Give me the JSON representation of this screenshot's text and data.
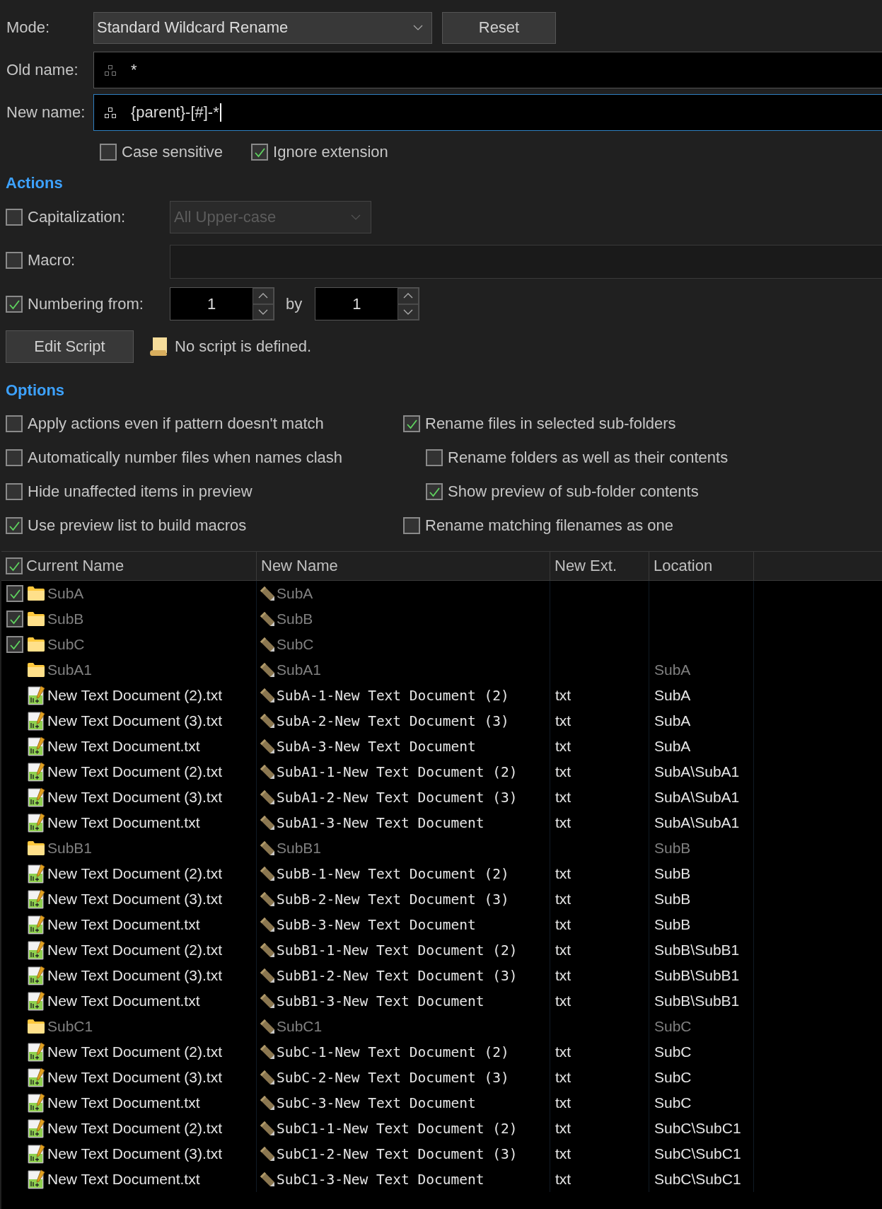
{
  "mode": {
    "label": "Mode:",
    "value": "Standard Wildcard Rename"
  },
  "reset_button": "Reset",
  "old_name": {
    "label": "Old name:",
    "value": "*",
    "focused": false
  },
  "new_name": {
    "label": "New name:",
    "value": "{parent}-[#]-*",
    "focused": true
  },
  "flags": [
    {
      "label": "Case sensitive",
      "checked": false
    },
    {
      "label": "Ignore extension",
      "checked": true
    }
  ],
  "actions": {
    "heading": "Actions",
    "capitalization": {
      "label": "Capitalization:",
      "checked": false,
      "value": "All Upper-case",
      "disabled": true
    },
    "macro": {
      "label": "Macro:",
      "checked": false
    },
    "numbering": {
      "label": "Numbering from:",
      "checked": true,
      "from": "1",
      "by_label": "by",
      "by": "1"
    },
    "edit_script_button": "Edit Script",
    "script_status": "No script is defined."
  },
  "options": {
    "heading": "Options",
    "left": [
      {
        "label": "Apply actions even if pattern doesn't match",
        "checked": false
      },
      {
        "label": "Automatically number files when names clash",
        "checked": false
      },
      {
        "label": "Hide unaffected items in preview",
        "checked": false
      },
      {
        "label": "Use preview list to build macros",
        "checked": true
      }
    ],
    "right": [
      {
        "label": "Rename files in selected sub-folders",
        "checked": true,
        "children": [
          {
            "label": "Rename folders as well as their contents",
            "checked": false
          },
          {
            "label": "Show preview of sub-folder contents",
            "checked": true
          }
        ]
      },
      {
        "label": "Rename matching filenames as one",
        "checked": false
      }
    ]
  },
  "table": {
    "header_checked": true,
    "columns": [
      "Current Name",
      "New Name",
      "New Ext.",
      "Location"
    ],
    "rows": [
      {
        "kind": "top_folder",
        "checked": true,
        "name": "SubA",
        "new_name": "SubA"
      },
      {
        "kind": "top_folder",
        "checked": true,
        "name": "SubB",
        "new_name": "SubB"
      },
      {
        "kind": "top_folder",
        "checked": true,
        "name": "SubC",
        "new_name": "SubC"
      },
      {
        "kind": "folder",
        "name": "SubA1",
        "new_name": "SubA1",
        "location": "SubA"
      },
      {
        "kind": "file",
        "name": "New Text Document (2).txt",
        "new_name": "SubA-1-New Text Document (2)",
        "ext": "txt",
        "location": "SubA"
      },
      {
        "kind": "file",
        "name": "New Text Document (3).txt",
        "new_name": "SubA-2-New Text Document (3)",
        "ext": "txt",
        "location": "SubA"
      },
      {
        "kind": "file",
        "name": "New Text Document.txt",
        "new_name": "SubA-3-New Text Document",
        "ext": "txt",
        "location": "SubA"
      },
      {
        "kind": "file",
        "name": "New Text Document (2).txt",
        "new_name": "SubA1-1-New Text Document (2)",
        "ext": "txt",
        "location": "SubA\\SubA1"
      },
      {
        "kind": "file",
        "name": "New Text Document (3).txt",
        "new_name": "SubA1-2-New Text Document (3)",
        "ext": "txt",
        "location": "SubA\\SubA1"
      },
      {
        "kind": "file",
        "name": "New Text Document.txt",
        "new_name": "SubA1-3-New Text Document",
        "ext": "txt",
        "location": "SubA\\SubA1"
      },
      {
        "kind": "folder",
        "name": "SubB1",
        "new_name": "SubB1",
        "location": "SubB"
      },
      {
        "kind": "file",
        "name": "New Text Document (2).txt",
        "new_name": "SubB-1-New Text Document (2)",
        "ext": "txt",
        "location": "SubB"
      },
      {
        "kind": "file",
        "name": "New Text Document (3).txt",
        "new_name": "SubB-2-New Text Document (3)",
        "ext": "txt",
        "location": "SubB"
      },
      {
        "kind": "file",
        "name": "New Text Document.txt",
        "new_name": "SubB-3-New Text Document",
        "ext": "txt",
        "location": "SubB"
      },
      {
        "kind": "file",
        "name": "New Text Document (2).txt",
        "new_name": "SubB1-1-New Text Document (2)",
        "ext": "txt",
        "location": "SubB\\SubB1"
      },
      {
        "kind": "file",
        "name": "New Text Document (3).txt",
        "new_name": "SubB1-2-New Text Document (3)",
        "ext": "txt",
        "location": "SubB\\SubB1"
      },
      {
        "kind": "file",
        "name": "New Text Document.txt",
        "new_name": "SubB1-3-New Text Document",
        "ext": "txt",
        "location": "SubB\\SubB1"
      },
      {
        "kind": "folder",
        "name": "SubC1",
        "new_name": "SubC1",
        "location": "SubC"
      },
      {
        "kind": "file",
        "name": "New Text Document (2).txt",
        "new_name": "SubC-1-New Text Document (2)",
        "ext": "txt",
        "location": "SubC"
      },
      {
        "kind": "file",
        "name": "New Text Document (3).txt",
        "new_name": "SubC-2-New Text Document (3)",
        "ext": "txt",
        "location": "SubC"
      },
      {
        "kind": "file",
        "name": "New Text Document.txt",
        "new_name": "SubC-3-New Text Document",
        "ext": "txt",
        "location": "SubC"
      },
      {
        "kind": "file",
        "name": "New Text Document (2).txt",
        "new_name": "SubC1-1-New Text Document (2)",
        "ext": "txt",
        "location": "SubC\\SubC1"
      },
      {
        "kind": "file",
        "name": "New Text Document (3).txt",
        "new_name": "SubC1-2-New Text Document (3)",
        "ext": "txt",
        "location": "SubC\\SubC1"
      },
      {
        "kind": "file",
        "name": "New Text Document.txt",
        "new_name": "SubC1-3-New Text Document",
        "ext": "txt",
        "location": "SubC\\SubC1"
      }
    ]
  }
}
